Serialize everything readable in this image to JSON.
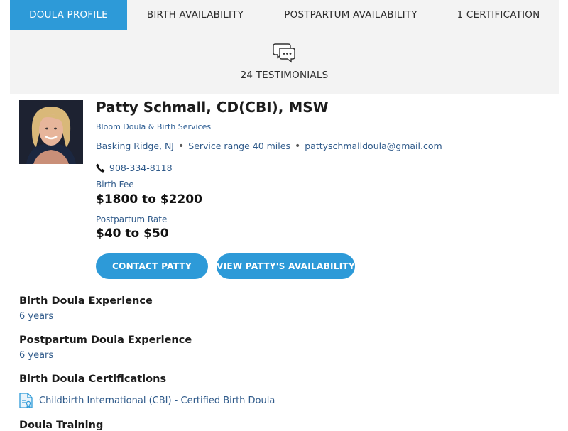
{
  "tabs": [
    {
      "label": "DOULA PROFILE"
    },
    {
      "label": "BIRTH AVAILABILITY"
    },
    {
      "label": "POSTPARTUM AVAILABILITY"
    },
    {
      "label": "1 CERTIFICATION"
    }
  ],
  "testimonials": {
    "label": "24 TESTIMONIALS",
    "icon": "chat-bubbles-icon"
  },
  "profile": {
    "name": "Patty Schmall, CD(CBI), MSW",
    "business": "Bloom Doula & Birth Services",
    "location": "Basking Ridge, NJ",
    "service_range": "Service range 40 miles",
    "email": "pattyschmalldoula@gmail.com",
    "phone": "908-334-8118",
    "birth_fee_label": "Birth Fee",
    "birth_fee": "$1800 to $2200",
    "postpartum_label": "Postpartum Rate",
    "postpartum_rate": "$40 to $50"
  },
  "buttons": {
    "contact": "CONTACT PATTY",
    "availability": "VIEW PATTY'S AVAILABILITY"
  },
  "sections": {
    "birth_exp_title": "Birth Doula Experience",
    "birth_exp_value": "6 years",
    "pp_exp_title": "Postpartum Doula Experience",
    "pp_exp_value": "6 years",
    "certs_title": "Birth Doula Certifications",
    "cert_item": "Childbirth International (CBI) - Certified Birth Doula",
    "training_title": "Doula Training"
  },
  "colors": {
    "accent": "#2d9ad8",
    "link": "#2f5a8a",
    "panel": "#f3f3f3"
  }
}
